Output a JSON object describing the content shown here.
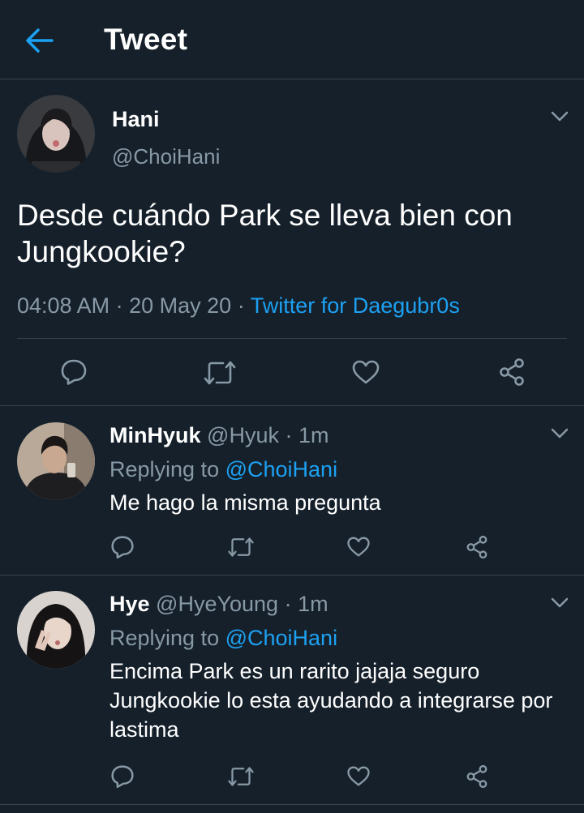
{
  "header": {
    "title": "Tweet",
    "back_icon": "arrow-left-icon",
    "accent": "#1da1f2"
  },
  "tweet": {
    "name": "Hani",
    "handle": "@ChoiHani",
    "text": "Desde cuándo Park se lleva bien con Jungkookie?",
    "time": "04:08 AM",
    "date": "20 May 20",
    "sep": "·",
    "client": "Twitter for Daegubr0s",
    "actions": [
      "reply-icon",
      "retweet-icon",
      "like-icon",
      "share-icon"
    ]
  },
  "replies": [
    {
      "name": "MinHyuk",
      "handle": "@Hyuk",
      "time": "1m",
      "replying_label": "Replying to",
      "mention": "@ChoiHani",
      "text": "Me hago la misma pregunta"
    },
    {
      "name": "Hye",
      "handle": "@HyeYoung",
      "time": "1m",
      "replying_label": "Replying to",
      "mention": "@ChoiHani",
      "text": "Encima Park es un rarito jajaja seguro Jungkookie lo esta ayudando a integrarse por lastima"
    }
  ],
  "colors": {
    "background": "#15202b",
    "border": "#38444d",
    "secondary_text": "#8899a6",
    "link": "#1da1f2"
  }
}
